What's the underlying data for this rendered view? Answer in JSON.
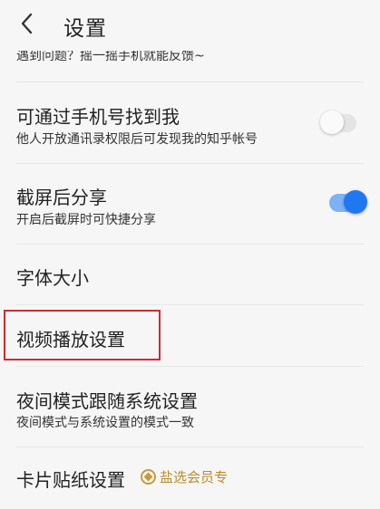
{
  "header": {
    "title": "设置",
    "back_icon": "chevron-left-icon"
  },
  "cut_hint": "遇到问题？摇一摇手机就能反馈~",
  "rows": [
    {
      "title": "可通过手机号找到我",
      "subtitle": "他人开放通讯录权限后可发现我的知乎帐号",
      "toggle": "off"
    },
    {
      "title": "截屏后分享",
      "subtitle": "开启后截屏时可快捷分享",
      "toggle": "on"
    },
    {
      "title": "字体大小"
    },
    {
      "title": "视频播放设置",
      "highlighted": true
    },
    {
      "title": "夜间模式跟随系统设置",
      "subtitle": "夜间模式与系统设置的模式一致"
    },
    {
      "title": "卡片贴纸设置",
      "badge": "盐选会员专"
    }
  ],
  "colors": {
    "accent": "#1f78f0",
    "highlight_border": "#d8292d",
    "vip_gold": "#c08a2a"
  }
}
